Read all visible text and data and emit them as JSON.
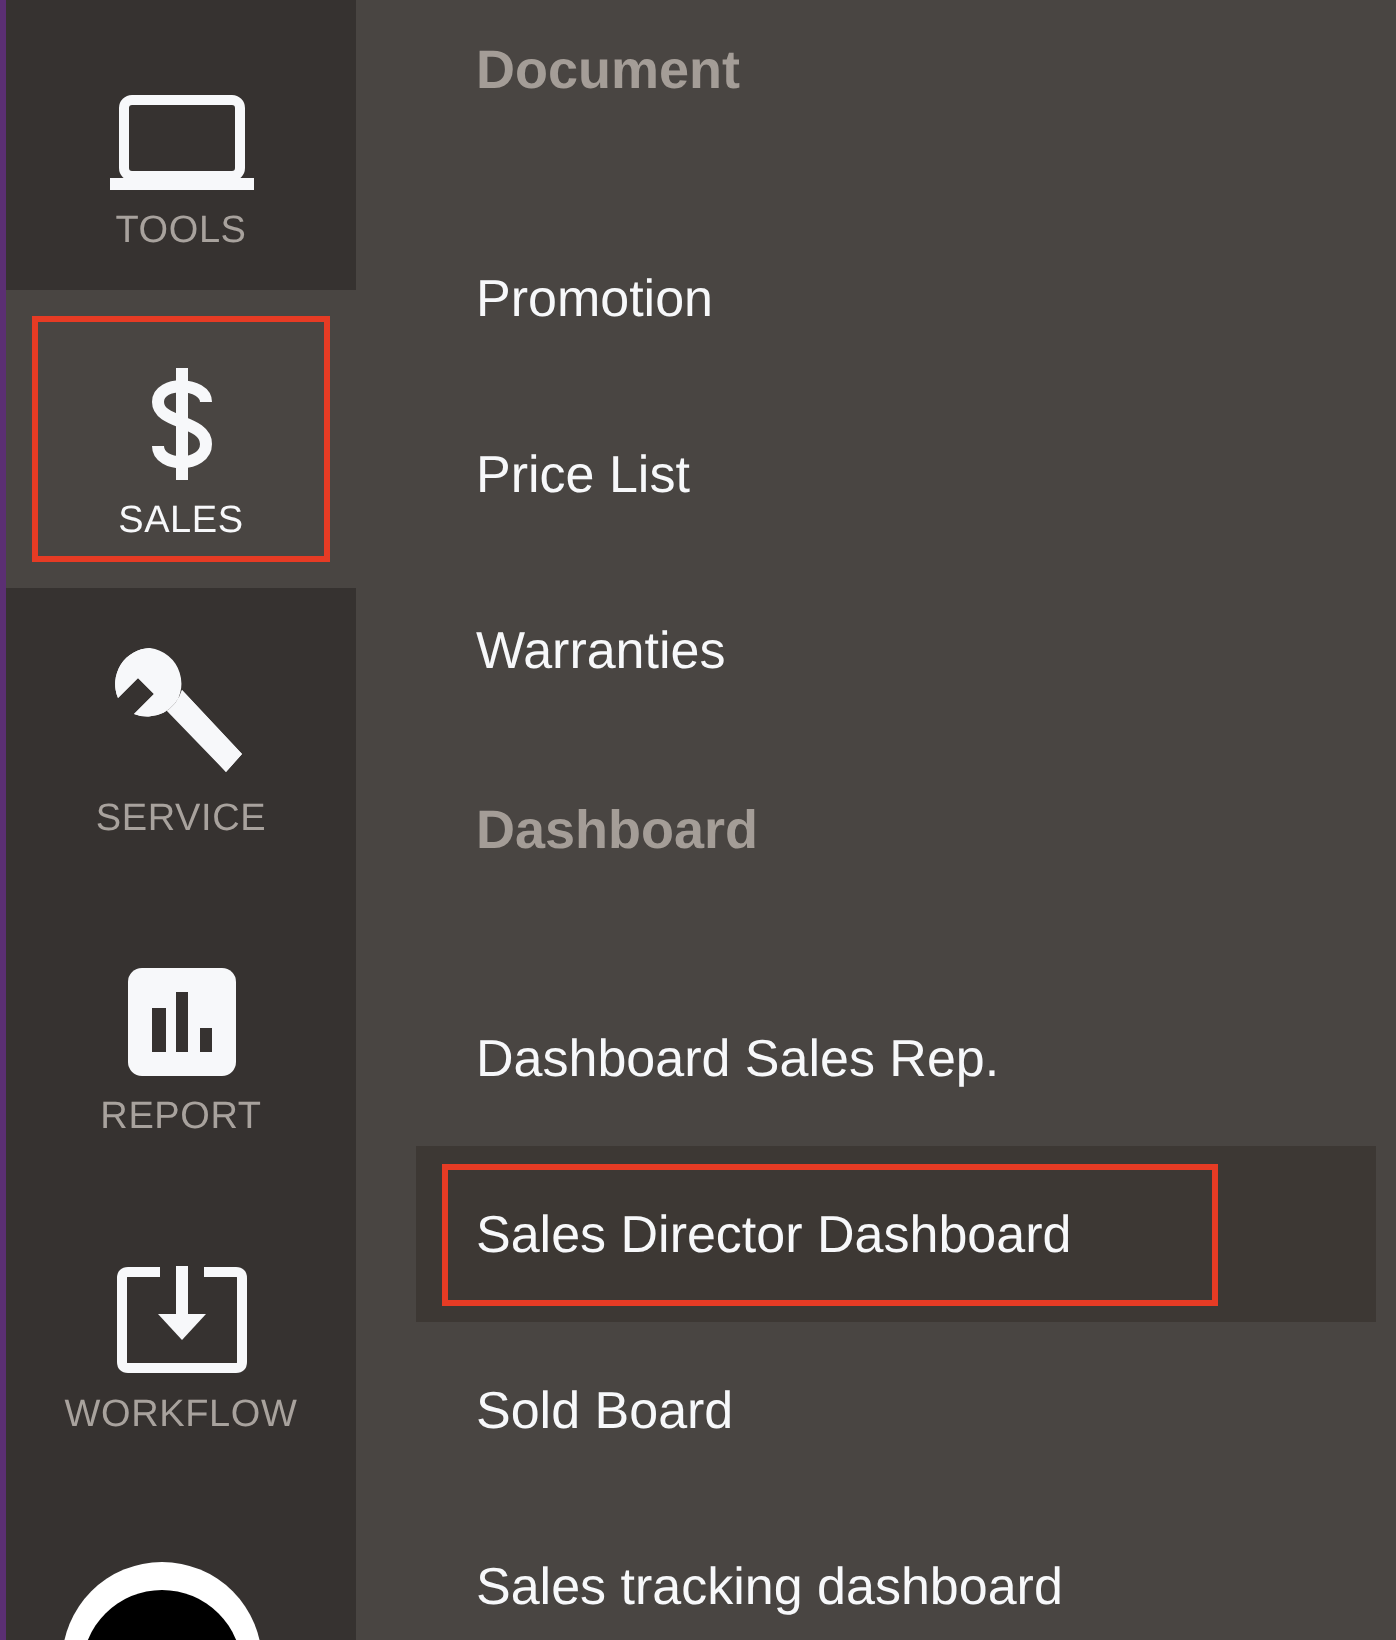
{
  "sidebar": {
    "items": [
      {
        "label": "TOOLS",
        "kind": "laptop",
        "selected": false,
        "highlighted": false
      },
      {
        "label": "SALES",
        "kind": "dollar",
        "selected": true,
        "highlighted": true
      },
      {
        "label": "SERVICE",
        "kind": "wrench",
        "selected": false,
        "highlighted": false
      },
      {
        "label": "REPORT",
        "kind": "chart",
        "selected": false,
        "highlighted": false
      },
      {
        "label": "WORKFLOW",
        "kind": "download",
        "selected": false,
        "highlighted": false
      }
    ],
    "avatar": {
      "kind": "avatar"
    }
  },
  "menu": {
    "sections": [
      {
        "title": "Document",
        "items": [
          {
            "label": "Promotion",
            "selected": false,
            "highlighted": false
          },
          {
            "label": "Price List",
            "selected": false,
            "highlighted": false
          },
          {
            "label": "Warranties",
            "selected": false,
            "highlighted": false
          }
        ]
      },
      {
        "title": "Dashboard",
        "items": [
          {
            "label": "Dashboard Sales Rep.",
            "selected": false,
            "highlighted": false
          },
          {
            "label": "Sales Director Dashboard",
            "selected": true,
            "highlighted": true
          },
          {
            "label": "Sold Board",
            "selected": false,
            "highlighted": false
          },
          {
            "label": "Sales tracking dashboard",
            "selected": false,
            "highlighted": false
          }
        ]
      }
    ]
  }
}
